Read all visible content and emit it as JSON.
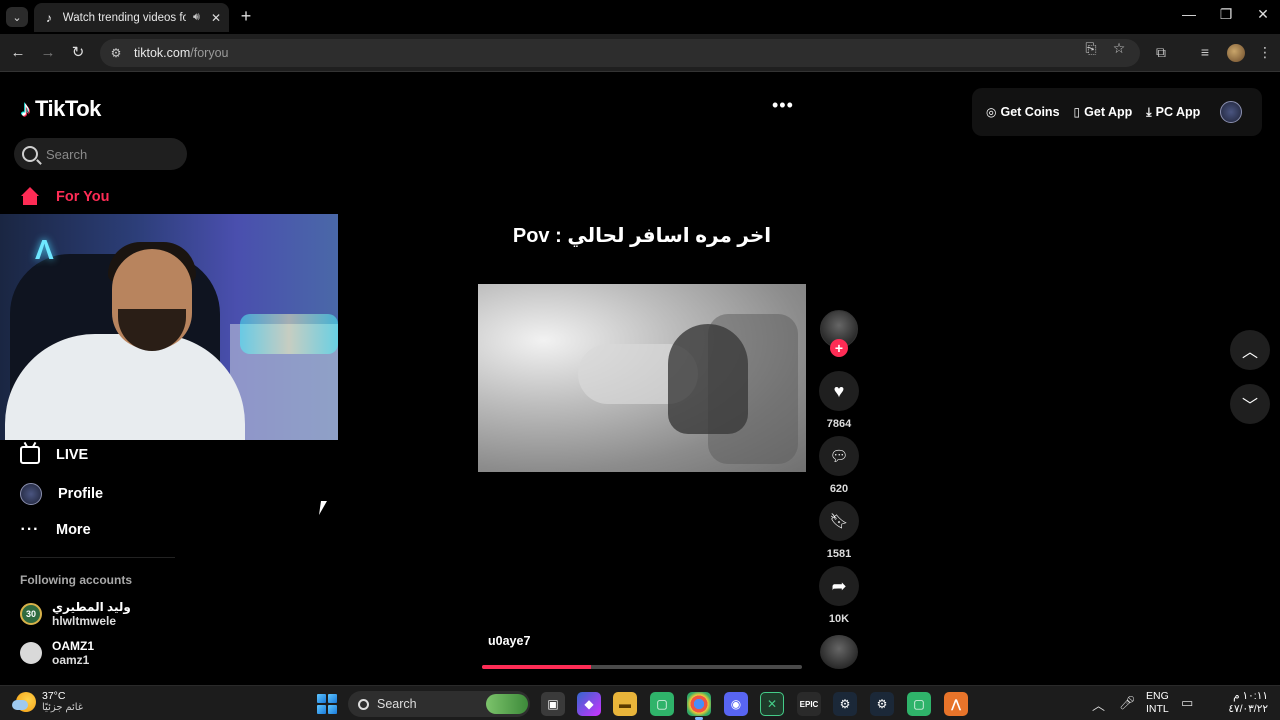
{
  "browser": {
    "tab_title": "Watch trending videos for y",
    "tab_favicon": "tiktok-note-icon",
    "url_host": "tiktok.com",
    "url_path": "/foryou"
  },
  "sidebar": {
    "logo_text": "TikTok",
    "search_placeholder": "Search",
    "nav": {
      "for_you": "For You",
      "live": "LIVE",
      "profile": "Profile",
      "more": "More"
    },
    "following_title": "Following accounts",
    "accounts": [
      {
        "display_name": "وليد المطيري",
        "handle": "hlwltmwele",
        "badge": "30"
      },
      {
        "display_name": "OAMZ1",
        "handle": "oamz1"
      }
    ]
  },
  "header": {
    "more_icon": "ellipsis-icon",
    "get_coins": "Get Coins",
    "get_app": "Get App",
    "pc_app": "PC App"
  },
  "video": {
    "caption": "اخر مره اسافر لحالي : Pov",
    "author": "u0aye7",
    "progress": 0.34,
    "likes": "7864",
    "comments": "620",
    "saves": "1581",
    "shares": "10K"
  },
  "colors": {
    "accent": "#fe2c55",
    "cyan": "#25f4ee",
    "background": "#000000",
    "surface": "#1f1f1f"
  },
  "taskbar": {
    "temperature": "37°C",
    "weather_text": "غائم جزئيًا",
    "search_label": "Search",
    "lang_top": "ENG",
    "lang_bottom": "INTL",
    "time": "١٠:١١ م",
    "date": "٤٧/٠٣/٢٢"
  }
}
